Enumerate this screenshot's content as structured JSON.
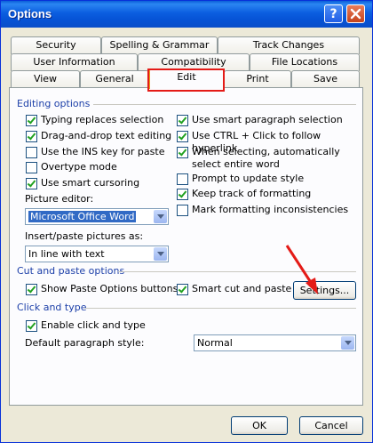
{
  "window": {
    "title": "Options",
    "help_glyph": "?"
  },
  "tabs": {
    "row1": [
      "Security",
      "Spelling & Grammar",
      "Track Changes"
    ],
    "row2": [
      "User Information",
      "Compatibility",
      "File Locations"
    ],
    "row3": [
      "View",
      "General",
      "Edit",
      "Print",
      "Save"
    ],
    "active": "Edit"
  },
  "editing": {
    "title": "Editing options",
    "left": [
      {
        "label": "Typing replaces selection",
        "checked": true
      },
      {
        "label": "Drag-and-drop text editing",
        "checked": true
      },
      {
        "label": "Use the INS key for paste",
        "checked": false
      },
      {
        "label": "Overtype mode",
        "checked": false
      },
      {
        "label": "Use smart cursoring",
        "checked": true
      }
    ],
    "right": [
      {
        "label": "Use smart paragraph selection",
        "checked": true
      },
      {
        "label": "Use CTRL + Click to follow hyperlink",
        "checked": true
      },
      {
        "label": "When selecting, automatically select entire word",
        "checked": true
      },
      {
        "label": "Prompt to update style",
        "checked": false
      },
      {
        "label": "Keep track of formatting",
        "checked": true
      },
      {
        "label": "Mark formatting inconsistencies",
        "checked": false
      }
    ],
    "picture_editor_label": "Picture editor:",
    "picture_editor_value": "Microsoft Office Word",
    "insert_paste_label": "Insert/paste pictures as:",
    "insert_paste_value": "In line with text"
  },
  "cut_paste": {
    "title": "Cut and paste options",
    "show_paste_options": {
      "label": "Show Paste Options buttons",
      "checked": true
    },
    "smart_cut": {
      "label": "Smart cut and paste",
      "checked": true
    },
    "settings_label": "Settings..."
  },
  "click_type": {
    "title": "Click and type",
    "enable": {
      "label": "Enable click and type",
      "checked": true
    },
    "default_style_label": "Default paragraph style:",
    "default_style_value": "Normal"
  },
  "footer": {
    "ok_label": "OK",
    "cancel_label": "Cancel"
  },
  "colors": {
    "title_bar": "#0653d6",
    "highlight": "#e41b17",
    "section_title": "#1c3fa8"
  }
}
